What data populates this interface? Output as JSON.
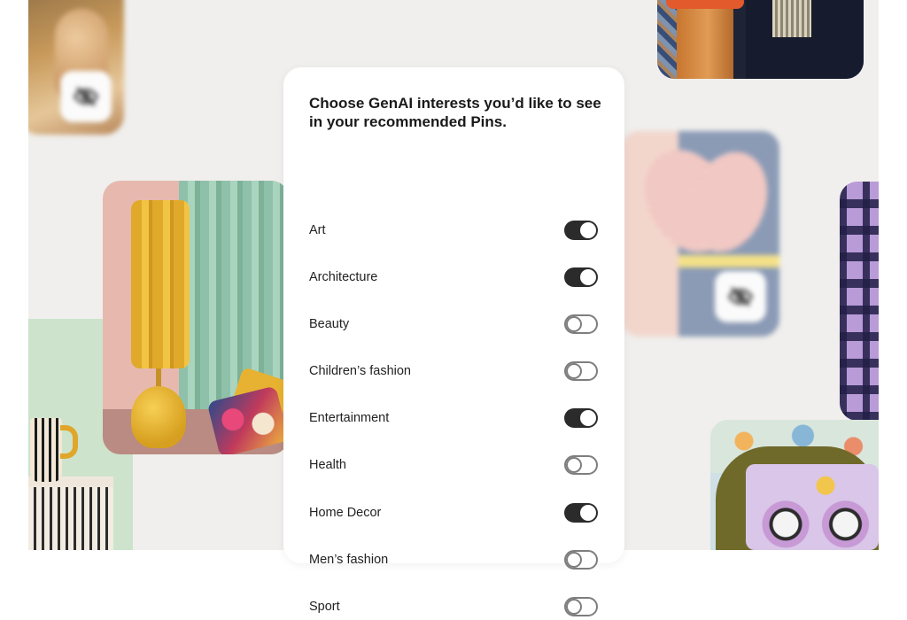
{
  "card": {
    "title": "Choose GenAI interests you’d like to see in your recommended Pins.",
    "interests": [
      {
        "label": "Art",
        "enabled": true
      },
      {
        "label": "Architecture",
        "enabled": true
      },
      {
        "label": "Beauty",
        "enabled": false
      },
      {
        "label": "Children’s fashion",
        "enabled": false
      },
      {
        "label": "Entertainment",
        "enabled": true
      },
      {
        "label": "Health",
        "enabled": false
      },
      {
        "label": "Home Decor",
        "enabled": true
      },
      {
        "label": "Men’s fashion",
        "enabled": false
      },
      {
        "label": "Sport",
        "enabled": false
      }
    ]
  },
  "background_pins": [
    {
      "name": "hand-pin",
      "hidden_icon": "eye-off-icon"
    },
    {
      "name": "stool-sofa-pin"
    },
    {
      "name": "yellow-lamp-pin"
    },
    {
      "name": "mug-stool-pin"
    },
    {
      "name": "tennis-racket-pin",
      "hidden_icon": "eye-off-icon"
    },
    {
      "name": "plaid-pin"
    },
    {
      "name": "floral-chair-pin"
    }
  ],
  "colors": {
    "toggle_on": "#2b2b2b",
    "toggle_off_border": "#7e7e7e",
    "background": "#f0efed",
    "card": "#ffffff"
  }
}
